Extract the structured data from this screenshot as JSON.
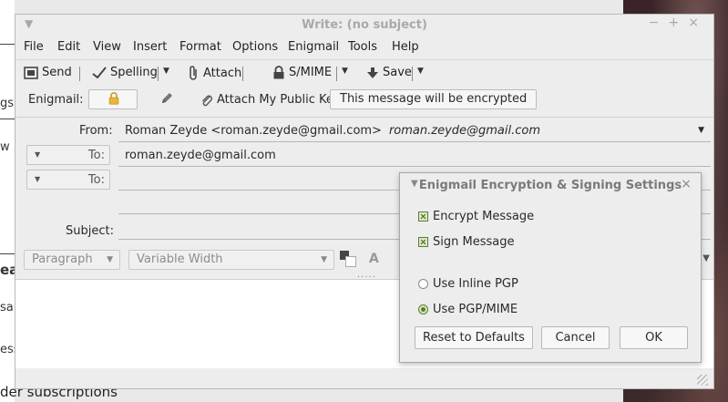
{
  "background": {
    "left_fragments": [
      "gs",
      "w",
      "ea",
      "sa",
      "ess"
    ],
    "bottom_text": "der subscriptions"
  },
  "window": {
    "title": "Write: (no subject)",
    "controls": [
      "−",
      "+",
      "×"
    ]
  },
  "menubar": {
    "items": [
      "File",
      "Edit",
      "View",
      "Insert",
      "Format",
      "Options",
      "Enigmail",
      "Tools",
      "Help"
    ]
  },
  "toolbar": {
    "send_label": "Send",
    "spelling_label": "Spelling",
    "attach_label": "Attach",
    "smime_label": "S/MIME",
    "save_label": "Save"
  },
  "enigmail_bar": {
    "label": "Enigmail:",
    "attach_key_label": "Attach My Public Key",
    "encryption_status": "This message will be encrypted"
  },
  "headers": {
    "from_label": "From:",
    "from_value": "Roman Zeyde <roman.zeyde@gmail.com>",
    "from_identity": "roman.zeyde@gmail.com",
    "to_label": "To:",
    "to_value": "roman.zeyde@gmail.com",
    "to2_label": "To:",
    "to2_value": "",
    "subject_label": "Subject:",
    "subject_value": ""
  },
  "format_bar": {
    "paragraph": "Paragraph",
    "font": "Variable Width"
  },
  "dialog": {
    "title": "Enigmail Encryption & Signing Settings",
    "encrypt_label": "Encrypt Message",
    "encrypt_checked": true,
    "sign_label": "Sign Message",
    "sign_checked": true,
    "inline_pgp_label": "Use Inline PGP",
    "pgp_mime_label": "Use PGP/MIME",
    "selected_mode": "PGP/MIME",
    "reset_label": "Reset to Defaults",
    "cancel_label": "Cancel",
    "ok_label": "OK"
  },
  "colors": {
    "check_accent": "#5b7d2f",
    "lock_yellow": "#e7b73a"
  }
}
